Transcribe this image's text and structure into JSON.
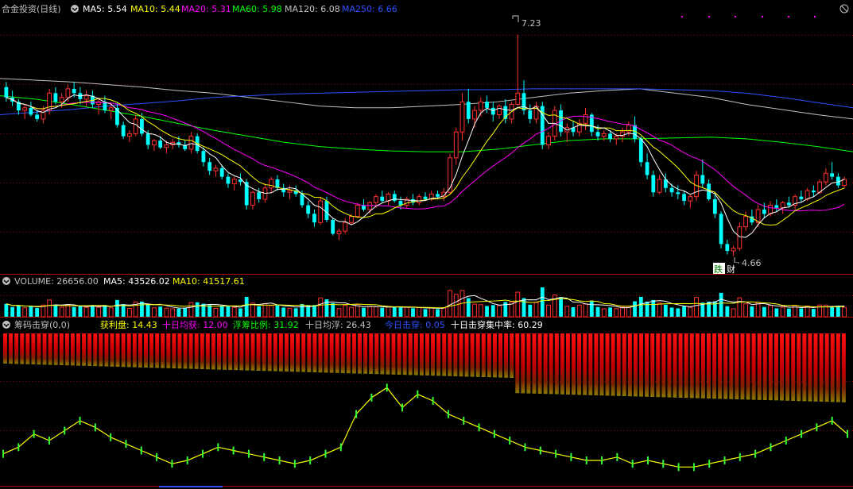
{
  "main": {
    "title": "合金投资(日线)",
    "ma": [
      {
        "label": "MA5: 5.54",
        "color": "#ffffff"
      },
      {
        "label": "MA10: 5.44",
        "color": "#ffff00"
      },
      {
        "label": "MA20: 5.31",
        "color": "#ff00ff"
      },
      {
        "label": "MA60: 5.98",
        "color": "#00ff00"
      },
      {
        "label": "MA120: 6.08",
        "color": "#c0c0c0"
      },
      {
        "label": "MA250: 6.66",
        "color": "#3050ff"
      }
    ],
    "high_label": "7.23",
    "low_label": "4.66",
    "badge1": "跌",
    "badge2": "财"
  },
  "volume": {
    "title": "VOLUME: 26656.00",
    "ma5": "MA5: 43526.02",
    "ma10": "MA10: 41517.61"
  },
  "chip": {
    "title": "筹码击穿(0,0)",
    "items": [
      {
        "label": "获利盘: 14.43",
        "color": "#ffff00"
      },
      {
        "label": "十日均获: 12.00",
        "color": "#ff00ff"
      },
      {
        "label": "浮筹比例: 31.92",
        "color": "#00ff00"
      },
      {
        "label": "十日均浮: 26.43",
        "color": "#c0c0c0"
      },
      {
        "label": "今日击穿: 0.05",
        "color": "#3050ff"
      },
      {
        "label": "十日击穿集中率: 60.29",
        "color": "#ffffff"
      }
    ]
  },
  "chart_data": {
    "type": "candlestick",
    "price_range": [
      4.5,
      7.4
    ],
    "colors": {
      "up": "#ff3030",
      "down": "#00ffff",
      "ma5": "#ffffff",
      "ma10": "#ffff00",
      "ma20": "#ff00ff",
      "ma60": "#00ff00",
      "ma120": "#c0c0c0",
      "ma250": "#3050ff"
    },
    "ohlc": [
      [
        6.62,
        6.68,
        6.45,
        6.5
      ],
      [
        6.5,
        6.58,
        6.4,
        6.45
      ],
      [
        6.45,
        6.48,
        6.3,
        6.35
      ],
      [
        6.35,
        6.42,
        6.25,
        6.38
      ],
      [
        6.38,
        6.45,
        6.28,
        6.3
      ],
      [
        6.3,
        6.35,
        6.22,
        6.25
      ],
      [
        6.25,
        6.4,
        6.2,
        6.35
      ],
      [
        6.35,
        6.6,
        6.3,
        6.55
      ],
      [
        6.55,
        6.62,
        6.42,
        6.45
      ],
      [
        6.45,
        6.55,
        6.38,
        6.5
      ],
      [
        6.5,
        6.65,
        6.45,
        6.6
      ],
      [
        6.6,
        6.68,
        6.5,
        6.55
      ],
      [
        6.55,
        6.62,
        6.42,
        6.48
      ],
      [
        6.48,
        6.58,
        6.4,
        6.52
      ],
      [
        6.52,
        6.58,
        6.38,
        6.42
      ],
      [
        6.42,
        6.5,
        6.3,
        6.45
      ],
      [
        6.45,
        6.52,
        6.32,
        6.35
      ],
      [
        6.35,
        6.42,
        6.25,
        6.38
      ],
      [
        6.38,
        6.45,
        6.15,
        6.18
      ],
      [
        6.18,
        6.22,
        6.02,
        6.05
      ],
      [
        6.05,
        6.12,
        5.98,
        6.08
      ],
      [
        6.08,
        6.3,
        6.05,
        6.25
      ],
      [
        6.25,
        6.32,
        6.05,
        6.08
      ],
      [
        6.08,
        6.12,
        5.9,
        5.95
      ],
      [
        5.95,
        6.02,
        5.88,
        6.0
      ],
      [
        6.0,
        6.05,
        5.9,
        5.92
      ],
      [
        5.92,
        6.0,
        5.85,
        5.95
      ],
      [
        5.95,
        6.02,
        5.9,
        5.98
      ],
      [
        5.98,
        6.05,
        5.92,
        5.95
      ],
      [
        5.95,
        6.0,
        5.88,
        5.9
      ],
      [
        5.9,
        6.1,
        5.85,
        6.05
      ],
      [
        6.05,
        6.08,
        5.85,
        5.88
      ],
      [
        5.88,
        5.92,
        5.7,
        5.75
      ],
      [
        5.75,
        5.8,
        5.6,
        5.65
      ],
      [
        5.65,
        5.72,
        5.58,
        5.68
      ],
      [
        5.68,
        5.72,
        5.55,
        5.58
      ],
      [
        5.58,
        5.62,
        5.45,
        5.5
      ],
      [
        5.5,
        5.58,
        5.42,
        5.55
      ],
      [
        5.55,
        5.62,
        5.48,
        5.52
      ],
      [
        5.52,
        5.55,
        5.2,
        5.25
      ],
      [
        5.25,
        5.42,
        5.2,
        5.4
      ],
      [
        5.4,
        5.45,
        5.28,
        5.32
      ],
      [
        5.32,
        5.5,
        5.28,
        5.45
      ],
      [
        5.45,
        5.58,
        5.4,
        5.55
      ],
      [
        5.55,
        5.6,
        5.42,
        5.45
      ],
      [
        5.45,
        5.5,
        5.35,
        5.4
      ],
      [
        5.4,
        5.48,
        5.32,
        5.42
      ],
      [
        5.42,
        5.48,
        5.35,
        5.38
      ],
      [
        5.38,
        5.42,
        5.22,
        5.25
      ],
      [
        5.25,
        5.3,
        5.1,
        5.15
      ],
      [
        5.15,
        5.2,
        5.0,
        5.05
      ],
      [
        5.05,
        5.35,
        5.02,
        5.3
      ],
      [
        5.3,
        5.35,
        5.05,
        5.08
      ],
      [
        5.08,
        5.1,
        4.9,
        4.92
      ],
      [
        4.92,
        4.98,
        4.85,
        4.95
      ],
      [
        4.95,
        5.1,
        4.92,
        5.05
      ],
      [
        5.05,
        5.15,
        5.02,
        5.12
      ],
      [
        5.12,
        5.28,
        5.1,
        5.25
      ],
      [
        5.25,
        5.32,
        5.18,
        5.2
      ],
      [
        5.2,
        5.3,
        5.15,
        5.28
      ],
      [
        5.28,
        5.38,
        5.22,
        5.35
      ],
      [
        5.35,
        5.42,
        5.28,
        5.3
      ],
      [
        5.3,
        5.4,
        5.25,
        5.38
      ],
      [
        5.38,
        5.42,
        5.28,
        5.3
      ],
      [
        5.3,
        5.35,
        5.2,
        5.25
      ],
      [
        5.25,
        5.35,
        5.22,
        5.32
      ],
      [
        5.32,
        5.38,
        5.25,
        5.28
      ],
      [
        5.28,
        5.38,
        5.25,
        5.35
      ],
      [
        5.35,
        5.4,
        5.3,
        5.32
      ],
      [
        5.32,
        5.42,
        5.3,
        5.38
      ],
      [
        5.38,
        5.42,
        5.32,
        5.35
      ],
      [
        5.35,
        5.45,
        5.3,
        5.4
      ],
      [
        5.4,
        5.85,
        5.38,
        5.8
      ],
      [
        5.8,
        6.15,
        5.72,
        6.1
      ],
      [
        6.1,
        6.55,
        6.0,
        6.45
      ],
      [
        6.45,
        6.6,
        6.2,
        6.25
      ],
      [
        6.25,
        6.4,
        6.15,
        6.35
      ],
      [
        6.35,
        6.5,
        6.28,
        6.45
      ],
      [
        6.45,
        6.52,
        6.32,
        6.38
      ],
      [
        6.38,
        6.45,
        6.22,
        6.3
      ],
      [
        6.3,
        6.42,
        6.25,
        6.4
      ],
      [
        6.4,
        6.48,
        6.2,
        6.25
      ],
      [
        6.25,
        6.45,
        6.2,
        6.42
      ],
      [
        6.42,
        7.23,
        6.4,
        6.55
      ],
      [
        6.55,
        6.7,
        6.3,
        6.35
      ],
      [
        6.35,
        6.42,
        6.2,
        6.25
      ],
      [
        6.25,
        6.45,
        6.2,
        6.4
      ],
      [
        6.4,
        6.45,
        5.9,
        5.95
      ],
      [
        5.95,
        6.1,
        5.9,
        6.05
      ],
      [
        6.05,
        6.4,
        6.0,
        6.35
      ],
      [
        6.35,
        6.42,
        6.05,
        6.1
      ],
      [
        6.1,
        6.2,
        5.98,
        6.15
      ],
      [
        6.15,
        6.22,
        6.05,
        6.1
      ],
      [
        6.1,
        6.25,
        6.05,
        6.2
      ],
      [
        6.2,
        6.38,
        6.12,
        6.3
      ],
      [
        6.3,
        6.32,
        6.05,
        6.1
      ],
      [
        6.1,
        6.18,
        6.0,
        6.05
      ],
      [
        6.05,
        6.12,
        6.0,
        6.08
      ],
      [
        6.08,
        6.12,
        5.98,
        6.02
      ],
      [
        6.02,
        6.08,
        5.95,
        6.05
      ],
      [
        6.05,
        6.15,
        5.98,
        6.1
      ],
      [
        6.1,
        6.22,
        6.05,
        6.18
      ],
      [
        6.18,
        6.28,
        5.98,
        6.02
      ],
      [
        6.02,
        6.05,
        5.7,
        5.75
      ],
      [
        5.75,
        5.85,
        5.55,
        5.6
      ],
      [
        5.6,
        5.65,
        5.35,
        5.4
      ],
      [
        5.4,
        5.6,
        5.38,
        5.55
      ],
      [
        5.55,
        5.62,
        5.4,
        5.45
      ],
      [
        5.45,
        5.5,
        5.35,
        5.4
      ],
      [
        5.4,
        5.48,
        5.32,
        5.38
      ],
      [
        5.38,
        5.42,
        5.25,
        5.3
      ],
      [
        5.3,
        5.38,
        5.22,
        5.35
      ],
      [
        5.35,
        5.65,
        5.3,
        5.6
      ],
      [
        5.6,
        5.78,
        5.45,
        5.5
      ],
      [
        5.5,
        5.55,
        5.3,
        5.32
      ],
      [
        5.32,
        5.38,
        5.1,
        5.15
      ],
      [
        5.15,
        5.18,
        4.75,
        4.8
      ],
      [
        4.8,
        4.85,
        4.68,
        4.72
      ],
      [
        4.72,
        4.78,
        4.66,
        4.75
      ],
      [
        4.75,
        5.05,
        4.72,
        5.0
      ],
      [
        5.0,
        5.18,
        4.95,
        5.12
      ],
      [
        5.12,
        5.2,
        5.02,
        5.05
      ],
      [
        5.05,
        5.25,
        5.0,
        5.2
      ],
      [
        5.2,
        5.28,
        5.1,
        5.15
      ],
      [
        5.15,
        5.3,
        5.12,
        5.25
      ],
      [
        5.25,
        5.32,
        5.18,
        5.22
      ],
      [
        5.22,
        5.3,
        5.15,
        5.28
      ],
      [
        5.28,
        5.35,
        5.22,
        5.25
      ],
      [
        5.25,
        5.38,
        5.2,
        5.35
      ],
      [
        5.35,
        5.42,
        5.28,
        5.32
      ],
      [
        5.32,
        5.45,
        5.3,
        5.42
      ],
      [
        5.42,
        5.48,
        5.35,
        5.4
      ],
      [
        5.4,
        5.55,
        5.38,
        5.52
      ],
      [
        5.52,
        5.68,
        5.48,
        5.62
      ],
      [
        5.62,
        5.75,
        5.55,
        5.58
      ],
      [
        5.58,
        5.62,
        5.45,
        5.48
      ],
      [
        5.48,
        5.58,
        5.45,
        5.55
      ]
    ],
    "ma120": [
      6.72,
      6.7,
      6.68,
      6.65,
      6.62,
      6.58,
      6.55,
      6.5,
      6.45,
      6.4,
      6.38,
      6.38,
      6.4,
      6.42,
      6.45,
      6.5,
      6.55,
      6.58,
      6.6,
      6.55,
      6.5,
      6.42,
      6.36,
      6.3,
      6.25
    ],
    "ma250": [
      6.3,
      6.33,
      6.36,
      6.4,
      6.43,
      6.46,
      6.5,
      6.52,
      6.54,
      6.55,
      6.56,
      6.57,
      6.58,
      6.59,
      6.59,
      6.6,
      6.6,
      6.6,
      6.6,
      6.59,
      6.58,
      6.55,
      6.5,
      6.44,
      6.38
    ],
    "ma60": [
      6.52,
      6.48,
      6.42,
      6.35,
      6.28,
      6.2,
      6.12,
      6.05,
      5.98,
      5.93,
      5.9,
      5.88,
      5.87,
      5.87,
      5.9,
      5.95,
      6.0,
      6.02,
      6.02,
      6.03,
      6.04,
      6.02,
      5.98,
      5.93,
      5.87
    ],
    "chip_profit": [
      8,
      10,
      14,
      12,
      15,
      18,
      16,
      13,
      11,
      9,
      7,
      5,
      6,
      8,
      10,
      9,
      8,
      7,
      6,
      5,
      6,
      8,
      10,
      20,
      25,
      28,
      22,
      26,
      24,
      20,
      18,
      16,
      14,
      12,
      10,
      9,
      8,
      7,
      6,
      6,
      7,
      5,
      6,
      5,
      4,
      4,
      5,
      6,
      7,
      8,
      10,
      12,
      14,
      16,
      18,
      14
    ]
  }
}
